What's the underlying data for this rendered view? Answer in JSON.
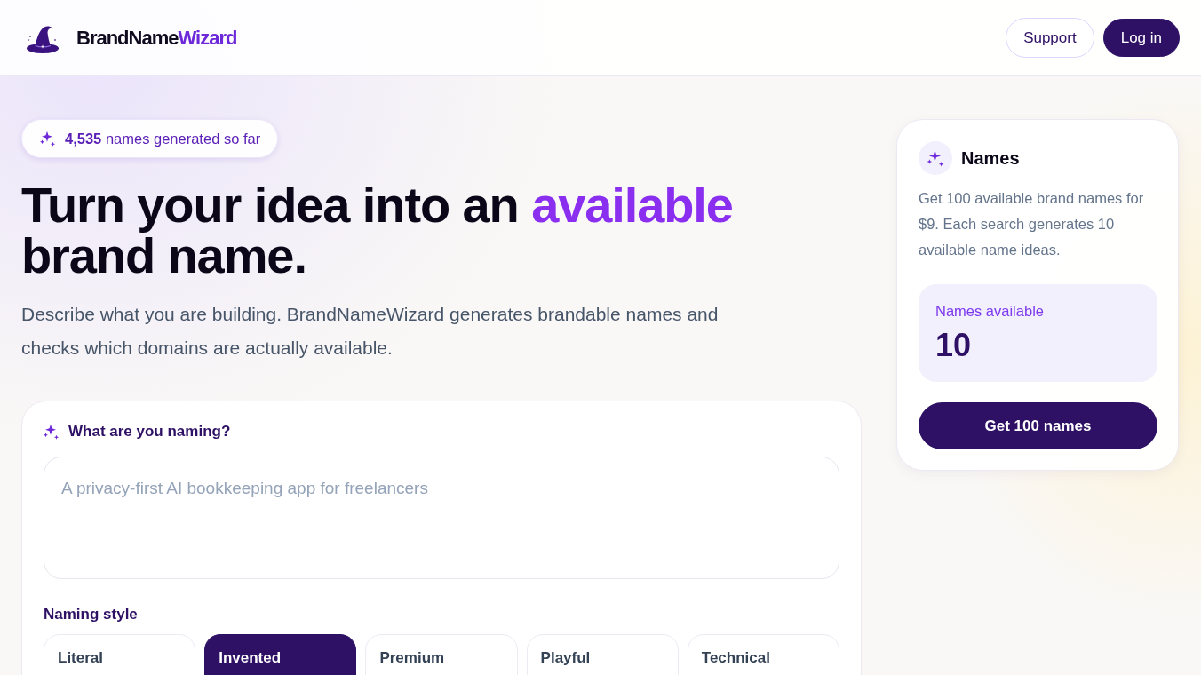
{
  "header": {
    "brand": {
      "primary": "BrandName",
      "accent": "Wizard"
    },
    "buttons": [
      {
        "label": "Support",
        "kind": "outline"
      },
      {
        "label": "Log in",
        "kind": "primary"
      }
    ]
  },
  "counter_badge": {
    "text": "**4,535** names generated so far"
  },
  "headline": {
    "before": "Turn your idea into an",
    "highlight": "available",
    "after": "brand name."
  },
  "subtitle": "Describe what you are building. BrandNameWizard generates brandable names and checks which domains are actually available.",
  "form": {
    "label": "What are you naming?",
    "idea_field": {
      "placeholder": "A privacy-first AI bookkeeping app for freelancers"
    },
    "style_label": "Naming style",
    "styles": [
      {
        "label": "Literal",
        "selected": false
      },
      {
        "label": "Invented",
        "selected": true
      },
      {
        "label": "Premium",
        "selected": false
      },
      {
        "label": "Playful",
        "selected": false
      },
      {
        "label": "Technical",
        "selected": false
      }
    ]
  },
  "plan_card": {
    "title": "Names",
    "description": "Get 100 available brand names for $9. Each search generates 10 available name ideas.",
    "stat": {
      "label": "Names available",
      "value": "10"
    },
    "button": "Get 100 names"
  }
}
